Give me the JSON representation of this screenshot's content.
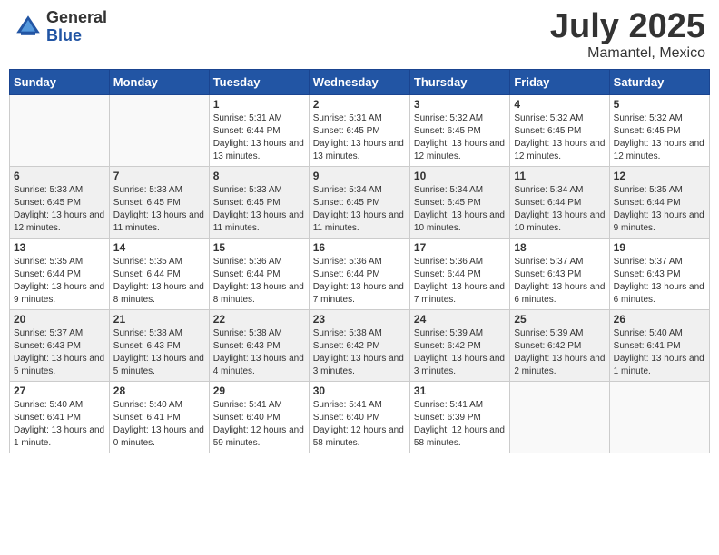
{
  "header": {
    "logo_general": "General",
    "logo_blue": "Blue",
    "month": "July 2025",
    "location": "Mamantel, Mexico"
  },
  "weekdays": [
    "Sunday",
    "Monday",
    "Tuesday",
    "Wednesday",
    "Thursday",
    "Friday",
    "Saturday"
  ],
  "weeks": [
    [
      {
        "day": "",
        "sunrise": "",
        "sunset": "",
        "daylight": ""
      },
      {
        "day": "",
        "sunrise": "",
        "sunset": "",
        "daylight": ""
      },
      {
        "day": "1",
        "sunrise": "Sunrise: 5:31 AM",
        "sunset": "Sunset: 6:44 PM",
        "daylight": "Daylight: 13 hours and 13 minutes."
      },
      {
        "day": "2",
        "sunrise": "Sunrise: 5:31 AM",
        "sunset": "Sunset: 6:45 PM",
        "daylight": "Daylight: 13 hours and 13 minutes."
      },
      {
        "day": "3",
        "sunrise": "Sunrise: 5:32 AM",
        "sunset": "Sunset: 6:45 PM",
        "daylight": "Daylight: 13 hours and 12 minutes."
      },
      {
        "day": "4",
        "sunrise": "Sunrise: 5:32 AM",
        "sunset": "Sunset: 6:45 PM",
        "daylight": "Daylight: 13 hours and 12 minutes."
      },
      {
        "day": "5",
        "sunrise": "Sunrise: 5:32 AM",
        "sunset": "Sunset: 6:45 PM",
        "daylight": "Daylight: 13 hours and 12 minutes."
      }
    ],
    [
      {
        "day": "6",
        "sunrise": "Sunrise: 5:33 AM",
        "sunset": "Sunset: 6:45 PM",
        "daylight": "Daylight: 13 hours and 12 minutes."
      },
      {
        "day": "7",
        "sunrise": "Sunrise: 5:33 AM",
        "sunset": "Sunset: 6:45 PM",
        "daylight": "Daylight: 13 hours and 11 minutes."
      },
      {
        "day": "8",
        "sunrise": "Sunrise: 5:33 AM",
        "sunset": "Sunset: 6:45 PM",
        "daylight": "Daylight: 13 hours and 11 minutes."
      },
      {
        "day": "9",
        "sunrise": "Sunrise: 5:34 AM",
        "sunset": "Sunset: 6:45 PM",
        "daylight": "Daylight: 13 hours and 11 minutes."
      },
      {
        "day": "10",
        "sunrise": "Sunrise: 5:34 AM",
        "sunset": "Sunset: 6:45 PM",
        "daylight": "Daylight: 13 hours and 10 minutes."
      },
      {
        "day": "11",
        "sunrise": "Sunrise: 5:34 AM",
        "sunset": "Sunset: 6:44 PM",
        "daylight": "Daylight: 13 hours and 10 minutes."
      },
      {
        "day": "12",
        "sunrise": "Sunrise: 5:35 AM",
        "sunset": "Sunset: 6:44 PM",
        "daylight": "Daylight: 13 hours and 9 minutes."
      }
    ],
    [
      {
        "day": "13",
        "sunrise": "Sunrise: 5:35 AM",
        "sunset": "Sunset: 6:44 PM",
        "daylight": "Daylight: 13 hours and 9 minutes."
      },
      {
        "day": "14",
        "sunrise": "Sunrise: 5:35 AM",
        "sunset": "Sunset: 6:44 PM",
        "daylight": "Daylight: 13 hours and 8 minutes."
      },
      {
        "day": "15",
        "sunrise": "Sunrise: 5:36 AM",
        "sunset": "Sunset: 6:44 PM",
        "daylight": "Daylight: 13 hours and 8 minutes."
      },
      {
        "day": "16",
        "sunrise": "Sunrise: 5:36 AM",
        "sunset": "Sunset: 6:44 PM",
        "daylight": "Daylight: 13 hours and 7 minutes."
      },
      {
        "day": "17",
        "sunrise": "Sunrise: 5:36 AM",
        "sunset": "Sunset: 6:44 PM",
        "daylight": "Daylight: 13 hours and 7 minutes."
      },
      {
        "day": "18",
        "sunrise": "Sunrise: 5:37 AM",
        "sunset": "Sunset: 6:43 PM",
        "daylight": "Daylight: 13 hours and 6 minutes."
      },
      {
        "day": "19",
        "sunrise": "Sunrise: 5:37 AM",
        "sunset": "Sunset: 6:43 PM",
        "daylight": "Daylight: 13 hours and 6 minutes."
      }
    ],
    [
      {
        "day": "20",
        "sunrise": "Sunrise: 5:37 AM",
        "sunset": "Sunset: 6:43 PM",
        "daylight": "Daylight: 13 hours and 5 minutes."
      },
      {
        "day": "21",
        "sunrise": "Sunrise: 5:38 AM",
        "sunset": "Sunset: 6:43 PM",
        "daylight": "Daylight: 13 hours and 5 minutes."
      },
      {
        "day": "22",
        "sunrise": "Sunrise: 5:38 AM",
        "sunset": "Sunset: 6:43 PM",
        "daylight": "Daylight: 13 hours and 4 minutes."
      },
      {
        "day": "23",
        "sunrise": "Sunrise: 5:38 AM",
        "sunset": "Sunset: 6:42 PM",
        "daylight": "Daylight: 13 hours and 3 minutes."
      },
      {
        "day": "24",
        "sunrise": "Sunrise: 5:39 AM",
        "sunset": "Sunset: 6:42 PM",
        "daylight": "Daylight: 13 hours and 3 minutes."
      },
      {
        "day": "25",
        "sunrise": "Sunrise: 5:39 AM",
        "sunset": "Sunset: 6:42 PM",
        "daylight": "Daylight: 13 hours and 2 minutes."
      },
      {
        "day": "26",
        "sunrise": "Sunrise: 5:40 AM",
        "sunset": "Sunset: 6:41 PM",
        "daylight": "Daylight: 13 hours and 1 minute."
      }
    ],
    [
      {
        "day": "27",
        "sunrise": "Sunrise: 5:40 AM",
        "sunset": "Sunset: 6:41 PM",
        "daylight": "Daylight: 13 hours and 1 minute."
      },
      {
        "day": "28",
        "sunrise": "Sunrise: 5:40 AM",
        "sunset": "Sunset: 6:41 PM",
        "daylight": "Daylight: 13 hours and 0 minutes."
      },
      {
        "day": "29",
        "sunrise": "Sunrise: 5:41 AM",
        "sunset": "Sunset: 6:40 PM",
        "daylight": "Daylight: 12 hours and 59 minutes."
      },
      {
        "day": "30",
        "sunrise": "Sunrise: 5:41 AM",
        "sunset": "Sunset: 6:40 PM",
        "daylight": "Daylight: 12 hours and 58 minutes."
      },
      {
        "day": "31",
        "sunrise": "Sunrise: 5:41 AM",
        "sunset": "Sunset: 6:39 PM",
        "daylight": "Daylight: 12 hours and 58 minutes."
      },
      {
        "day": "",
        "sunrise": "",
        "sunset": "",
        "daylight": ""
      },
      {
        "day": "",
        "sunrise": "",
        "sunset": "",
        "daylight": ""
      }
    ]
  ]
}
